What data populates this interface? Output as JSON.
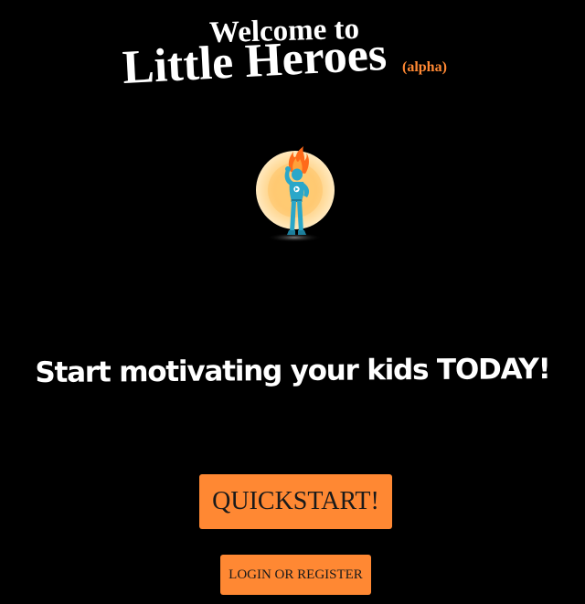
{
  "header": {
    "welcome": "Welcome to",
    "app_name": "Little Heroes",
    "badge": "(alpha)"
  },
  "hero": {
    "icon": "superhero-mascot-icon"
  },
  "tagline": "Start motivating your kids TODAY!",
  "actions": {
    "quickstart_label": "QUICKSTART!",
    "login_label": "LOGIN OR REGISTER"
  },
  "colors": {
    "background": "#000000",
    "accent": "#ff8833",
    "text": "#ffffff",
    "button_text": "#1a1a1a"
  }
}
